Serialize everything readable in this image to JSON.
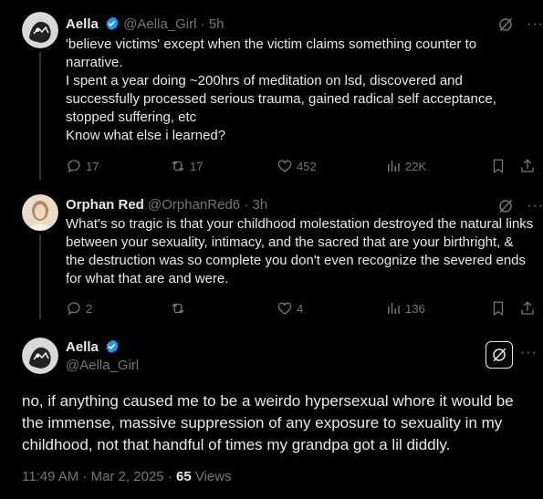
{
  "tweet1": {
    "name": "Aella",
    "handle": "@Aella_Girl",
    "time": "5h",
    "lines": [
      "'believe victims' except when the victim claims something counter to narrative.",
      "I spent a year doing ~200hrs of meditation on lsd, discovered and successfully processed serious trauma, gained radical self acceptance, stopped suffering, etc",
      "Know what else i learned?"
    ],
    "replies": "17",
    "reposts": "17",
    "likes": "452",
    "views": "22K"
  },
  "tweet2": {
    "name": "Orphan Red",
    "handle": "@OrphanRed6",
    "time": "3h",
    "text": "What's so tragic is that your childhood molestation destroyed the natural links between your sexuality, intimacy, and the sacred that are your birthright, & the destruction was so complete you don't even recognize the severed ends for what that are and were.",
    "replies": "2",
    "reposts": "",
    "likes": "4",
    "views": "136"
  },
  "focus": {
    "name": "Aella",
    "handle": "@Aella_Girl",
    "text": "no, if anything caused me to be a weirdo hypersexual whore it would be the immense, massive suppression of any exposure to sexuality in my childhood, not that handful of times my grandpa got a lil diddly.",
    "timestamp": "11:49 AM · Mar 2, 2025 · ",
    "views_count": "65",
    "views_label": " Views"
  },
  "separator": "·",
  "more_glyph": "···",
  "colors": {
    "accent": "#1d9bf0",
    "muted": "#71767b",
    "text": "#e7e9ea",
    "background": "#000000"
  },
  "icons": [
    "verified-badge-icon",
    "grok-icon",
    "more-icon",
    "reply-icon",
    "repost-icon",
    "like-icon",
    "views-icon",
    "bookmark-icon",
    "share-icon"
  ]
}
